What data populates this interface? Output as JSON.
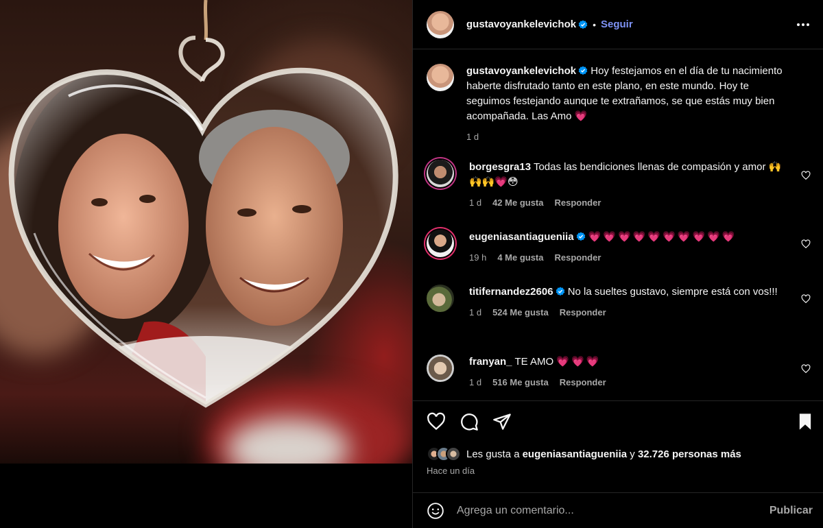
{
  "colors": {
    "background": "#000000",
    "text": "#f5f5f5",
    "muted": "#a8a8a8",
    "link": "#7e93f5",
    "verified": "#0095f6",
    "heart": "#ff2d6f",
    "divider": "#262626"
  },
  "post": {
    "author": "gustavoyankelevichok",
    "follow_label": "Seguir",
    "separator": "•",
    "more_icon": "more-horizontal-icon"
  },
  "caption": {
    "username": "gustavoyankelevichok",
    "text": "Hoy festejamos en el día de tu nacimiento haberte disfrutado tanto en este plano, en este mundo. Hoy te seguimos festejando aunque te extrañamos, se que estás muy bien acompañada. Las Amo ",
    "emoji": "💗",
    "time": "1 d"
  },
  "comments": [
    {
      "username": "borgesgra13",
      "verified": false,
      "text": "Todas las bendiciones llenas de compasión y amor ",
      "emoji": "🙌🙌🙌💗😳",
      "time": "1 d",
      "likes": "42 Me gusta",
      "reply": "Responder"
    },
    {
      "username": "eugeniasantiagueniia",
      "verified": true,
      "text": "",
      "emoji": "💗💗💗💗💗💗💗💗💗💗",
      "time": "19 h",
      "likes": "4 Me gusta",
      "reply": "Responder"
    },
    {
      "username": "titifernandez2606",
      "verified": true,
      "text": "No la sueltes gustavo, siempre está con vos!!!",
      "emoji": "",
      "time": "1 d",
      "likes": "524 Me gusta",
      "reply": "Responder"
    },
    {
      "username": "franyan_",
      "verified": false,
      "text": "TE AMO ",
      "emoji": "💗💗💗",
      "time": "1 d",
      "likes": "516 Me gusta",
      "reply": "Responder"
    }
  ],
  "likes": {
    "prefix": "Les gusta a ",
    "user": "eugeniasantiagueniia",
    "middle": " y ",
    "count": "32.726 personas más"
  },
  "time_ago": "Hace un día",
  "add_comment": {
    "placeholder": "Agrega un comentario...",
    "post_label": "Publicar"
  }
}
